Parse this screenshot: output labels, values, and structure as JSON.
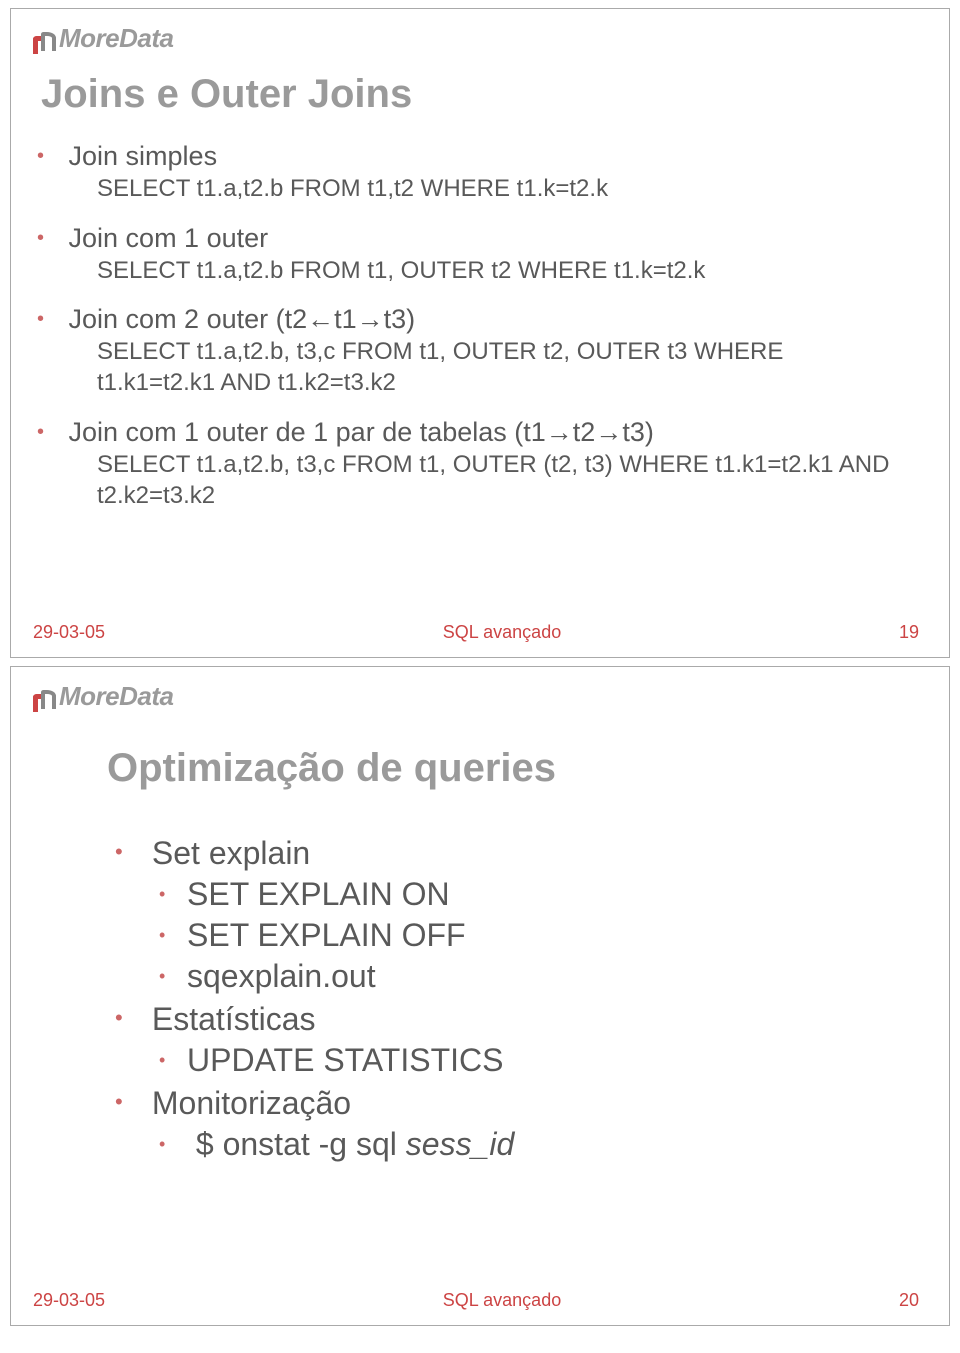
{
  "logo": {
    "text": "MoreData"
  },
  "slide1": {
    "title": "Joins e Outer Joins",
    "items": [
      {
        "label": "Join simples",
        "sql": "SELECT t1.a,t2.b FROM t1,t2 WHERE t1.k=t2.k"
      },
      {
        "label": "Join com 1 outer",
        "sql": "SELECT t1.a,t2.b FROM t1, OUTER t2 WHERE t1.k=t2.k"
      },
      {
        "label": "Join com 2 outer (t2←t1→t3)",
        "sql": "SELECT t1.a,t2.b, t3,c FROM t1, OUTER t2, OUTER t3 WHERE t1.k1=t2.k1 AND t1.k2=t3.k2"
      },
      {
        "label": "Join com 1 outer de 1 par de tabelas (t1→t2→t3)",
        "sql": "SELECT t1.a,t2.b, t3,c FROM t1, OUTER (t2, t3) WHERE t1.k1=t2.k1 AND t2.k2=t3.k2"
      }
    ],
    "footer": {
      "date": "29-03-05",
      "mid": "SQL avançado",
      "page": "19"
    }
  },
  "slide2": {
    "title": "Optimização de queries",
    "items": [
      {
        "label": "Set explain",
        "sub": [
          "SET EXPLAIN ON",
          "SET EXPLAIN OFF",
          "sqexplain.out"
        ]
      },
      {
        "label": "Estatísticas",
        "sub": [
          "UPDATE STATISTICS"
        ]
      },
      {
        "label": "Monitorização",
        "sub_prefix": "$ onstat -g sql ",
        "sub_italic": "sess_id"
      }
    ],
    "footer": {
      "date": "29-03-05",
      "mid": "SQL avançado",
      "page": "20"
    }
  }
}
